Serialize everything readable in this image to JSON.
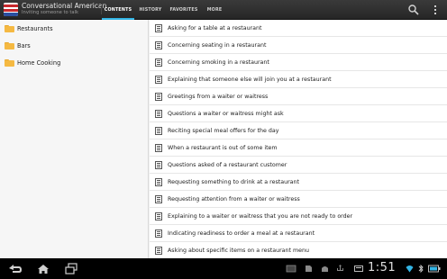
{
  "app": {
    "title": "Conversational American",
    "subtitle": "Inviting someone to talk"
  },
  "tabs": [
    {
      "label": "CONTENTS",
      "active": true
    },
    {
      "label": "HISTORY",
      "active": false
    },
    {
      "label": "FAVORITES",
      "active": false
    },
    {
      "label": "MORE",
      "active": false
    }
  ],
  "actions": {
    "search_icon": "search-icon",
    "overflow_icon": "overflow-menu-icon"
  },
  "sidebar": {
    "items": [
      {
        "label": "Restaurants",
        "icon": "folder-icon"
      },
      {
        "label": "Bars",
        "icon": "folder-icon"
      },
      {
        "label": "Home Cooking",
        "icon": "folder-icon"
      }
    ]
  },
  "list": {
    "items": [
      {
        "label": "Asking for a table at a restaurant"
      },
      {
        "label": "Concerning seating in a restaurant"
      },
      {
        "label": "Concerning smoking in a restaurant"
      },
      {
        "label": "Explaining that someone else will join you at a restaurant"
      },
      {
        "label": "Greetings from a waiter or waitress"
      },
      {
        "label": "Questions a waiter or waitress might ask"
      },
      {
        "label": "Reciting special meal offers for the day"
      },
      {
        "label": "When a restaurant is out of some item"
      },
      {
        "label": "Questions asked of a restaurant customer"
      },
      {
        "label": "Requesting something to drink at a restaurant"
      },
      {
        "label": "Requesting attention from a waiter or waitress"
      },
      {
        "label": "Explaining to a waiter or waitress that you are not ready to order"
      },
      {
        "label": "Indicating readiness to order a meal at a restaurant"
      },
      {
        "label": "Asking about specific items on a restaurant menu"
      }
    ]
  },
  "system_bar": {
    "clock": "1:51",
    "colors": {
      "accent": "#33b5e5",
      "clock_accent": "#33b5e5"
    }
  }
}
